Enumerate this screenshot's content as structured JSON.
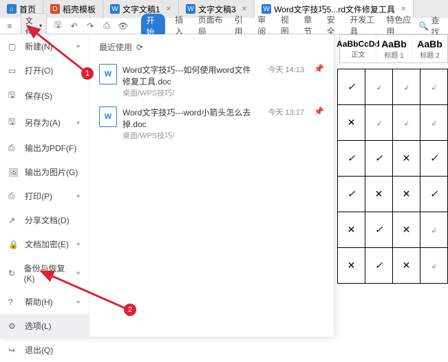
{
  "tabs": [
    {
      "icon": "home",
      "label": "首页"
    },
    {
      "icon": "d",
      "label": "稻壳模板"
    },
    {
      "icon": "w",
      "label": "文字文稿1"
    },
    {
      "icon": "w",
      "label": "文字文稿3"
    },
    {
      "icon": "w",
      "label": "Word文字技巧5...rd文件修复工具"
    }
  ],
  "file_btn": "文件",
  "ribbon": [
    "开始",
    "插入",
    "页面布局",
    "引用",
    "审阅",
    "视图",
    "章节",
    "安全",
    "开发工具",
    "特色应用"
  ],
  "search": "查找",
  "styles": [
    {
      "sample": "AaBbCcDd",
      "label": "正文",
      "big": false
    },
    {
      "sample": "AaBb",
      "label": "标题 1",
      "big": true
    },
    {
      "sample": "AaBb",
      "label": "标题 2",
      "big": true
    }
  ],
  "menu": {
    "items": [
      {
        "ic": "▢",
        "label": "新建(N)",
        "arrow": true
      },
      {
        "ic": "▭",
        "label": "打开(O)",
        "arrow": false
      },
      {
        "ic": "🖫",
        "label": "保存(S)",
        "arrow": false
      },
      {
        "ic": "🖫",
        "label": "另存为(A)",
        "arrow": true
      },
      {
        "ic": "⎙",
        "label": "输出为PDF(F)",
        "arrow": false
      },
      {
        "ic": "🖼",
        "label": "输出为图片(G)",
        "arrow": false
      },
      {
        "ic": "⎙",
        "label": "打印(P)",
        "arrow": true
      },
      {
        "ic": "↗",
        "label": "分享文档(D)",
        "arrow": false
      },
      {
        "ic": "🔒",
        "label": "文档加密(E)",
        "arrow": true
      },
      {
        "ic": "↻",
        "label": "备份与恢复(K)",
        "arrow": true
      },
      {
        "ic": "?",
        "label": "帮助(H)",
        "arrow": true
      },
      {
        "ic": "⚙",
        "label": "选项(L)",
        "arrow": false,
        "hl": true
      },
      {
        "ic": "↪",
        "label": "退出(Q)",
        "arrow": false
      }
    ],
    "recent_label": "最近使用",
    "recent": [
      {
        "name": "Word文字技巧---如何使用word文件修复工具.doc",
        "path": "桌面/WPS技巧/",
        "time": "今天 14:13"
      },
      {
        "name": "Word文字技巧---word小箭头怎么去掉.doc",
        "path": "桌面/WPS技巧/",
        "time": "今天 13:17"
      }
    ]
  },
  "anno": {
    "n1": "1",
    "n2": "2"
  },
  "table": [
    [
      "chk",
      "dot",
      "dot",
      "dot"
    ],
    [
      "crs",
      "dot",
      "dot",
      "dot"
    ],
    [
      "chk",
      "chk",
      "crs",
      "chk"
    ],
    [
      "chk",
      "crs",
      "crs",
      "chk"
    ],
    [
      "crs",
      "chk",
      "crs",
      "dot"
    ],
    [
      "crs",
      "chk",
      "crs",
      "dot"
    ]
  ]
}
